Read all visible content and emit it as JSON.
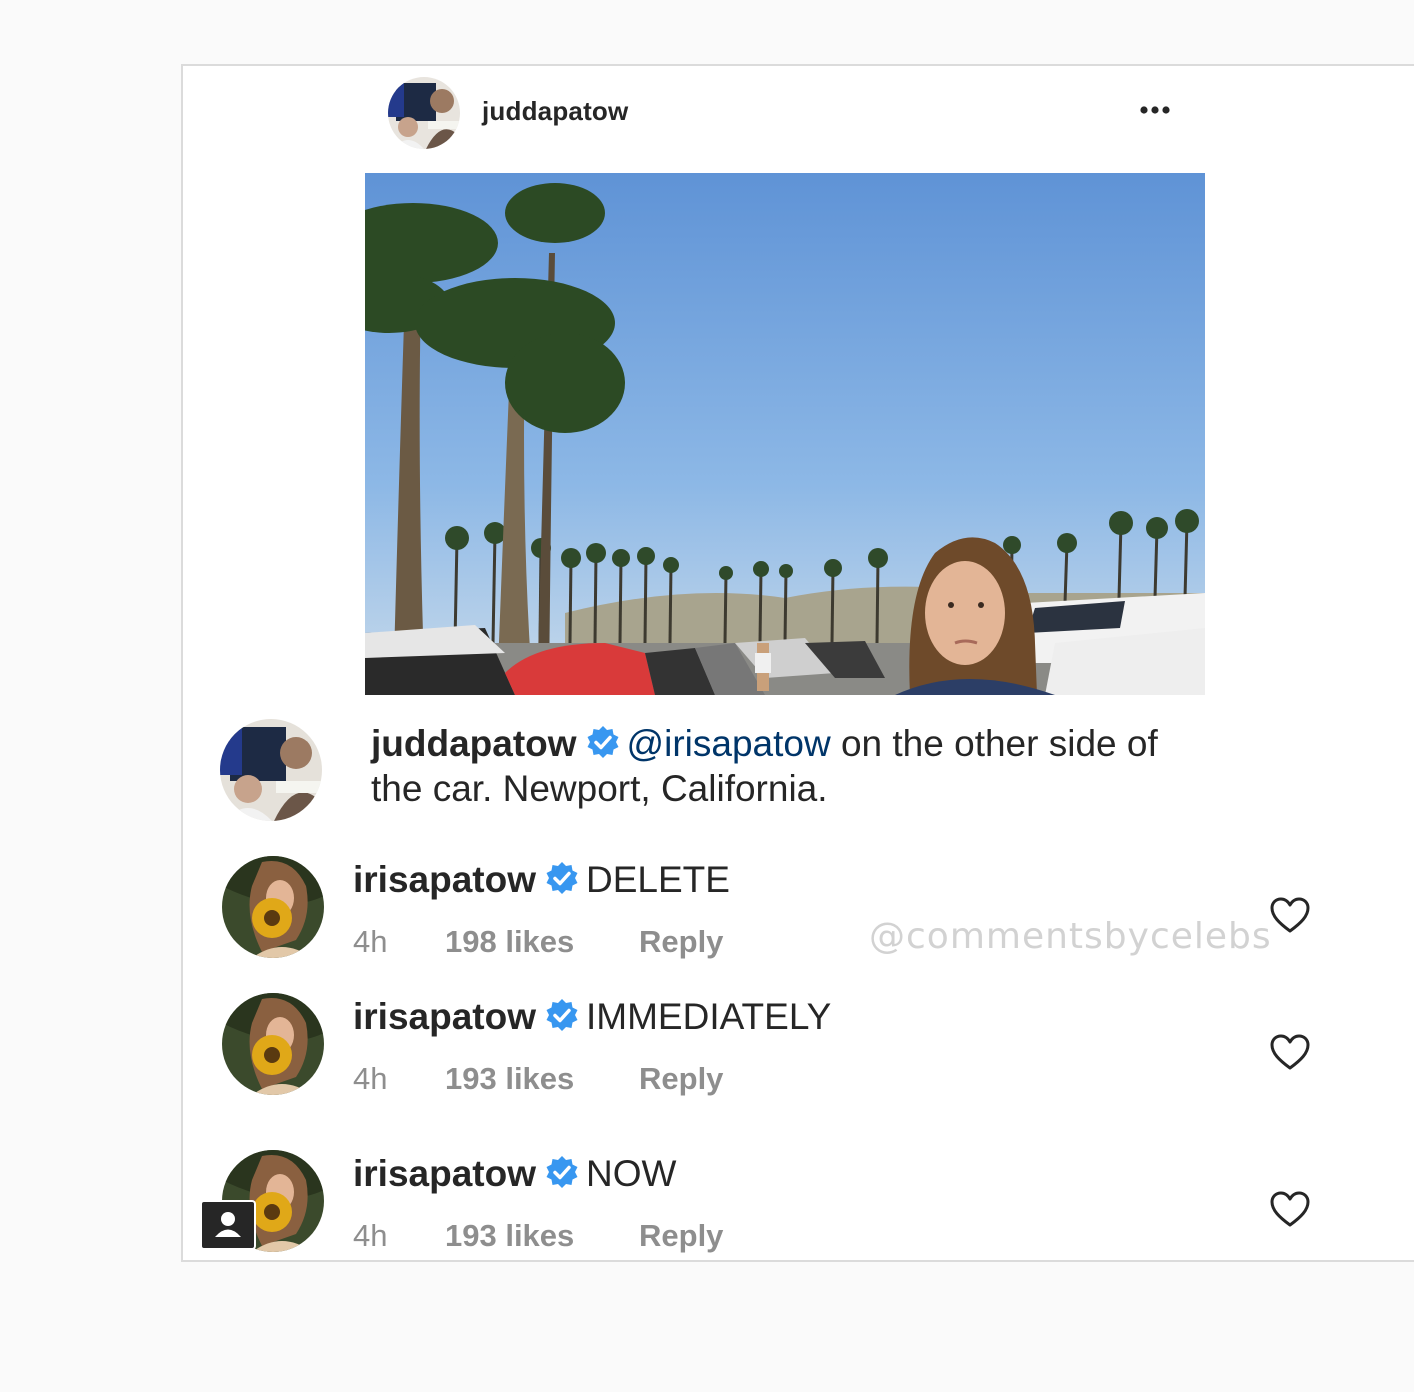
{
  "post": {
    "username": "juddapatow",
    "more_label": "•••"
  },
  "caption": {
    "username": "juddapatow",
    "mention": "@irisapatow",
    "text": " on the other side of the car. Newport, California."
  },
  "comments": [
    {
      "username": "irisapatow",
      "text": "DELETE",
      "time": "4h",
      "likes": "198 likes",
      "reply": "Reply"
    },
    {
      "username": "irisapatow",
      "text": "IMMEDIATELY",
      "time": "4h",
      "likes": "193 likes",
      "reply": "Reply"
    },
    {
      "username": "irisapatow",
      "text": "NOW",
      "time": "4h",
      "likes": "193 likes",
      "reply": "Reply"
    }
  ],
  "watermark": "@commentsbycelebs",
  "colors": {
    "verified": "#3897f0",
    "mention": "#003569",
    "meta": "#8e8e8e",
    "text": "#262626"
  },
  "icons": [
    "more-options-icon",
    "verified-badge-icon",
    "heart-icon",
    "user-tag-icon"
  ]
}
